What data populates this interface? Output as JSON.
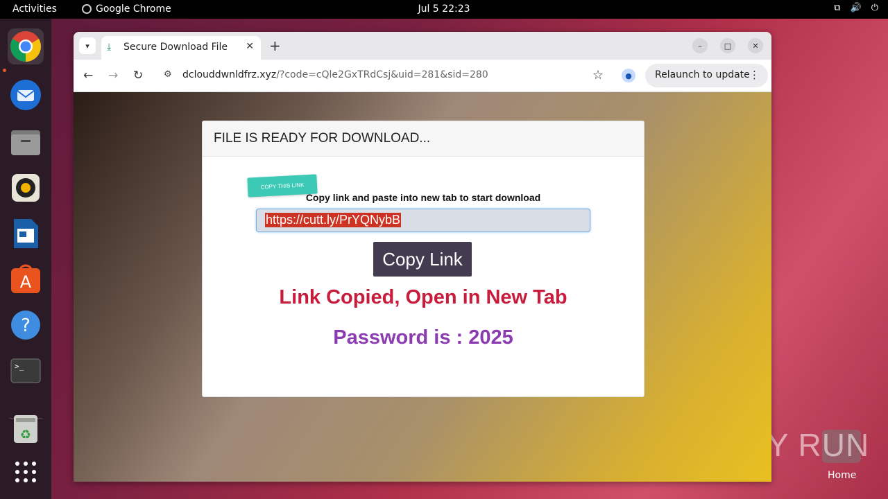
{
  "topbar": {
    "activities": "Activities",
    "app_name": "Google Chrome",
    "clock": "Jul 5  22:23"
  },
  "dock": {
    "items": [
      "chrome",
      "thunderbird",
      "files",
      "rhythmbox",
      "libreoffice-writer",
      "app-center",
      "help",
      "terminal",
      "trash",
      "show-apps"
    ]
  },
  "browser": {
    "tab_title": "Secure Download File",
    "url_host": "dclouddwnldfrz.xyz",
    "url_path": "/?code=cQle2GxTRdCsj&uid=281&sid=280",
    "relaunch_label": "Relaunch to update"
  },
  "page": {
    "header": "FILE IS READY FOR DOWNLOAD...",
    "sticker": "COPY THIS LINK",
    "instruction": "Copy link and paste into new tab to start download",
    "link_value": "https://cutt.ly/PrYQNybB",
    "copy_button": "Copy Link",
    "copied_message": "Link Copied, Open in New Tab",
    "password_message": "Password is : 2025"
  },
  "desktop": {
    "watermark": "ANY RUN",
    "home_label": "Home"
  },
  "colors": {
    "copied": "#c81c3c",
    "password": "#8a3cb0",
    "button": "#433c50",
    "sticker": "#3cc9b6"
  }
}
